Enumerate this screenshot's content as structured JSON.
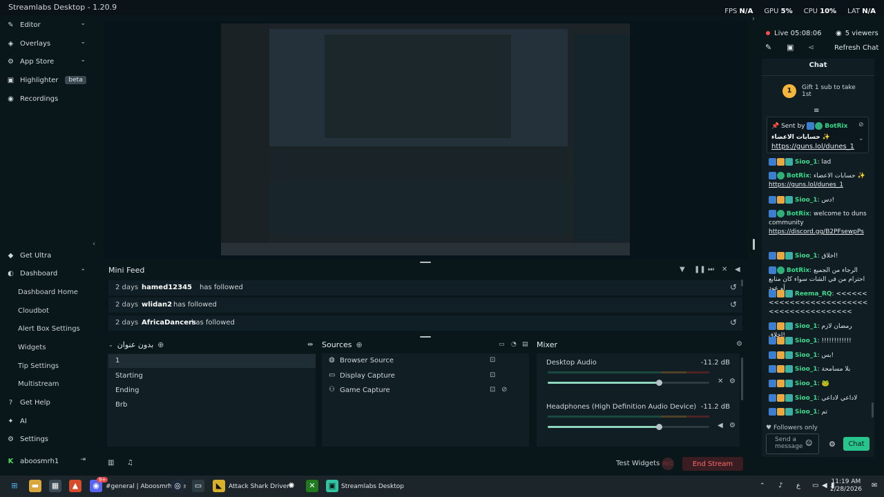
{
  "window": {
    "title": "Streamlabs Desktop - 1.20.9"
  },
  "stats": [
    {
      "label": "FPS",
      "value": "N/A"
    },
    {
      "label": "GPU",
      "value": "5%"
    },
    {
      "label": "CPU",
      "value": "10%"
    },
    {
      "label": "LAT",
      "value": "N/A"
    }
  ],
  "sidebar": {
    "top": [
      {
        "label": "Editor",
        "icon": "pencil-icon"
      },
      {
        "label": "Overlays",
        "icon": "overlay-icon"
      },
      {
        "label": "App Store",
        "icon": "store-icon"
      },
      {
        "label": "Highlighter",
        "badge": "beta",
        "icon": "highlighter-icon"
      },
      {
        "label": "Recordings",
        "icon": "record-icon"
      }
    ],
    "get_ultra": "Get Ultra",
    "dashboard": "Dashboard",
    "dashboard_items": [
      "Dashboard Home",
      "Cloudbot",
      "Alert Box Settings",
      "Widgets",
      "Tip Settings",
      "Multistream"
    ],
    "bottom": [
      "Get Help",
      "AI",
      "Settings"
    ],
    "user": "aboosmrh1"
  },
  "minifeed": {
    "title": "Mini Feed",
    "rows": [
      {
        "time": "2 days",
        "name": "hamed12345",
        "action": "has followed"
      },
      {
        "time": "2 days",
        "name": "wlidan2",
        "action": "has followed"
      },
      {
        "time": "2 days",
        "name": "AfricaDancers",
        "action": "has followed"
      }
    ]
  },
  "scenes": {
    "title": "بدون عنوان",
    "items": [
      "1",
      "Starting",
      "Ending",
      "Brb"
    ]
  },
  "sources": {
    "title": "Sources",
    "items": [
      "Browser Source",
      "Display Capture",
      "Game Capture"
    ]
  },
  "mixer": {
    "title": "Mixer",
    "channels": [
      {
        "name": "Desktop Audio",
        "db": "-11.2 dB",
        "level": 0.69
      },
      {
        "name": "Headphones (High Definition Audio Device)",
        "db": "-11.2 dB",
        "level": 0.69
      }
    ]
  },
  "footer": {
    "test_widgets": "Test Widgets",
    "rec": "REC",
    "end_stream": "End Stream"
  },
  "live": {
    "status": "Live 05:08:06",
    "viewers": "5 viewers",
    "refresh": "Refresh Chat"
  },
  "chat": {
    "title": "Chat",
    "gift": "Gift 1 sub to take 1st",
    "gift_count": "1",
    "pinned": {
      "sent_by": "Sent by",
      "user": "BotRix",
      "text": "حسابات الاعضاء ✨",
      "link": "https://guns.lol/dunes_1"
    },
    "messages": [
      {
        "user": "Sioo_1",
        "text": "lad"
      },
      {
        "user": "BotRix",
        "text": "حسابات الاعضاء ✨",
        "link": "https://guns.lol/dunes_1"
      },
      {
        "user": "Sioo_1",
        "text": "دس!"
      },
      {
        "user": "BotRix",
        "text": "welcome to duns community",
        "link": "https://discord.gg/B2PFsewpPs"
      },
      {
        "user": "Sioo_1",
        "text": "اخلاق!"
      },
      {
        "user": "BotRix",
        "text": "الرجاء من الجميع احترام من في الشات سواء كان متابع أو عود"
      },
      {
        "user": "Reema_RQ",
        "text": "<<<<<<<<<<<<<<<<<<<<<<<<<<<<<<<<<<<<<<<<<"
      },
      {
        "user": "Sioo_1",
        "text": "رمضان لازم اخلاق!"
      },
      {
        "user": "Sioo_1",
        "text": "!!!!!!!!!!!!"
      },
      {
        "user": "Sioo_1",
        "text": "بس!"
      },
      {
        "user": "Sioo_1",
        "text": "بلا مسامحة"
      },
      {
        "user": "Sioo_1",
        "text": "🐸"
      },
      {
        "user": "Sioo_1",
        "text": "لاداعي لاداعي"
      },
      {
        "user": "Sioo_1",
        "text": "تم"
      }
    ],
    "followers_only": "Followers only",
    "input_placeholder": "Send a message",
    "send": "Chat"
  },
  "taskbar": {
    "apps": [
      "#general | Aboosmrh's se",
      "Attack Shark Driver",
      "Streamlabs Desktop"
    ],
    "discord_badge": "9+",
    "lang": "ع",
    "time": "11:19 AM",
    "date": "2/28/2026"
  }
}
